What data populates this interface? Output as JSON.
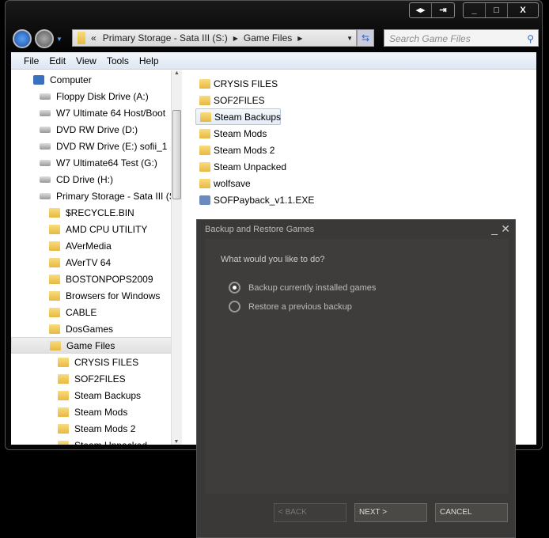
{
  "caption_buttons": [
    "◂▸",
    "⇥",
    "_",
    "□",
    "X"
  ],
  "address": {
    "overflow": "«",
    "segments": [
      "Primary Storage - Sata III (S:)",
      "Game  Files"
    ]
  },
  "search": {
    "placeholder": "Search Game  Files"
  },
  "menu": [
    "File",
    "Edit",
    "View",
    "Tools",
    "Help"
  ],
  "tree": [
    {
      "label": "Computer",
      "level": 0,
      "icon": "computer-icon"
    },
    {
      "label": "Floppy Disk Drive (A:)",
      "level": 1,
      "icon": "floppy-icon"
    },
    {
      "label": "W7 Ultimate 64 Host/Boot",
      "level": 1,
      "icon": "windows-drive-icon"
    },
    {
      "label": "DVD RW Drive (D:)",
      "level": 1,
      "icon": "dvd-icon"
    },
    {
      "label": "DVD RW Drive (E:) sofii_1",
      "level": 1,
      "icon": "dvd-icon"
    },
    {
      "label": "W7 Ultimate64 Test (G:)",
      "level": 1,
      "icon": "drive-icon"
    },
    {
      "label": "CD Drive (H:)",
      "level": 1,
      "icon": "cd-icon"
    },
    {
      "label": "Primary Storage - Sata III (S:)",
      "level": 1,
      "icon": "drive-icon"
    },
    {
      "label": "$RECYCLE.BIN",
      "level": 2,
      "icon": "folder-icon"
    },
    {
      "label": "AMD CPU UTILITY",
      "level": 2,
      "icon": "folder-icon"
    },
    {
      "label": "AVerMedia",
      "level": 2,
      "icon": "folder-icon"
    },
    {
      "label": "AVerTV 64",
      "level": 2,
      "icon": "folder-icon"
    },
    {
      "label": "BOSTONPOPS2009",
      "level": 2,
      "icon": "folder-icon"
    },
    {
      "label": "Browsers for Windows",
      "level": 2,
      "icon": "folder-icon"
    },
    {
      "label": "CABLE",
      "level": 2,
      "icon": "folder-icon"
    },
    {
      "label": "DosGames",
      "level": 2,
      "icon": "folder-icon"
    },
    {
      "label": "Game  Files",
      "level": 2,
      "icon": "folder-icon",
      "selected": true
    },
    {
      "label": "CRYSIS FILES",
      "level": 3,
      "icon": "folder-icon"
    },
    {
      "label": "SOF2FILES",
      "level": 3,
      "icon": "folder-icon"
    },
    {
      "label": "Steam Backups",
      "level": 3,
      "icon": "folder-icon"
    },
    {
      "label": "Steam Mods",
      "level": 3,
      "icon": "folder-icon"
    },
    {
      "label": "Steam Mods 2",
      "level": 3,
      "icon": "folder-icon"
    },
    {
      "label": "Steam Unpacked",
      "level": 3,
      "icon": "folder-icon"
    }
  ],
  "files": [
    {
      "label": "CRYSIS FILES",
      "icon": "folder-icon"
    },
    {
      "label": "SOF2FILES",
      "icon": "folder-icon"
    },
    {
      "label": "Steam Backups",
      "icon": "folder-icon",
      "selected": true
    },
    {
      "label": "Steam Mods",
      "icon": "folder-icon"
    },
    {
      "label": "Steam Mods 2",
      "icon": "folder-icon"
    },
    {
      "label": "Steam Unpacked",
      "icon": "folder-icon"
    },
    {
      "label": "wolfsave",
      "icon": "folder-icon"
    },
    {
      "label": "SOFPayback_v1.1.EXE",
      "icon": "exe-icon"
    }
  ],
  "dialog": {
    "title": "Backup and Restore Games",
    "question": "What would you like to do?",
    "options": [
      {
        "label": "Backup currently installed games",
        "selected": true
      },
      {
        "label": "Restore a previous backup",
        "selected": false
      }
    ],
    "back": "< BACK",
    "next": "NEXT >",
    "cancel": "CANCEL"
  }
}
